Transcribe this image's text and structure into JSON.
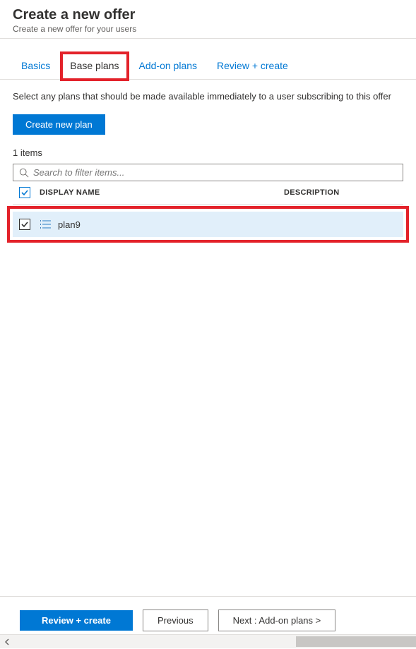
{
  "header": {
    "title": "Create a new offer",
    "subtitle": "Create a new offer for your users"
  },
  "tabs": {
    "basics": "Basics",
    "base_plans": "Base plans",
    "addon_plans": "Add-on plans",
    "review": "Review + create"
  },
  "content": {
    "description": "Select any plans that should be made available immediately to a user subscribing to this offer",
    "create_button": "Create new plan",
    "item_count": "1 items",
    "search_placeholder": "Search to filter items..."
  },
  "table": {
    "columns": {
      "display_name": "DISPLAY NAME",
      "description": "DESCRIPTION"
    },
    "rows": [
      {
        "name": "plan9",
        "description": ""
      }
    ]
  },
  "footer": {
    "review": "Review + create",
    "previous": "Previous",
    "next": "Next : Add-on plans >"
  }
}
